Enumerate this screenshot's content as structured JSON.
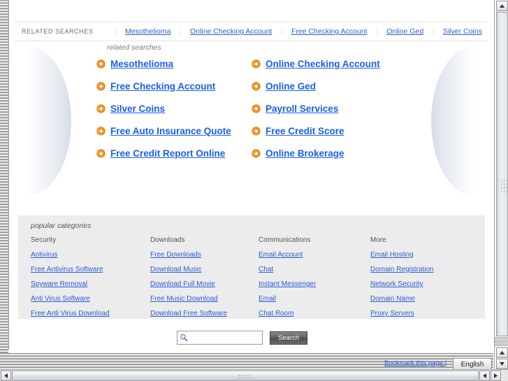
{
  "related_searches_bar": {
    "label": "RELATED SEARCHES",
    "separator": "::",
    "links": [
      "Mesothelioma",
      "Online Checking Account",
      "Free Checking Account",
      "Online Ged",
      "Silver Coins"
    ]
  },
  "related_searches_block": {
    "caption": "related searches",
    "icon": "circle-arrow-right-icon",
    "links": [
      "Mesothelioma",
      "Online Checking Account",
      "Free Checking Account",
      "Online Ged",
      "Silver Coins",
      "Payroll Services",
      "Free Auto Insurance Quote",
      "Free Credit Score",
      "Free Credit Report Online",
      "Online Brokerage"
    ]
  },
  "popular_categories": {
    "caption": "popular categories",
    "columns": [
      {
        "heading": "Security",
        "links": [
          "Antivirus",
          "Free Antivirus Software",
          "Spyware Removal",
          "Anti Virus Software",
          "Free Anti Virus Download"
        ]
      },
      {
        "heading": "Downloads",
        "links": [
          "Free Downloads",
          "Download Music",
          "Download Full Movie",
          "Free Music Download",
          "Download Free Software"
        ]
      },
      {
        "heading": "Communications",
        "links": [
          "Email Account",
          "Chat",
          "Instant Messenger",
          "Email",
          "Chat Room"
        ]
      },
      {
        "heading": "More",
        "links": [
          "Email Hosting",
          "Domain Registration",
          "Network Security",
          "Domain Name",
          "Proxy Servers"
        ]
      }
    ]
  },
  "search": {
    "value": "",
    "placeholder": "",
    "button_label": "Search",
    "icon": "magnifier-icon"
  },
  "footer": {
    "bookmark_label": "Bookmark this page |",
    "language": "English"
  },
  "colors": {
    "link_blue": "#2b5bd7",
    "big_link_blue": "#1a5ef0",
    "arrow_orange": "#ee8c1c",
    "panel_gray": "#ececec"
  }
}
